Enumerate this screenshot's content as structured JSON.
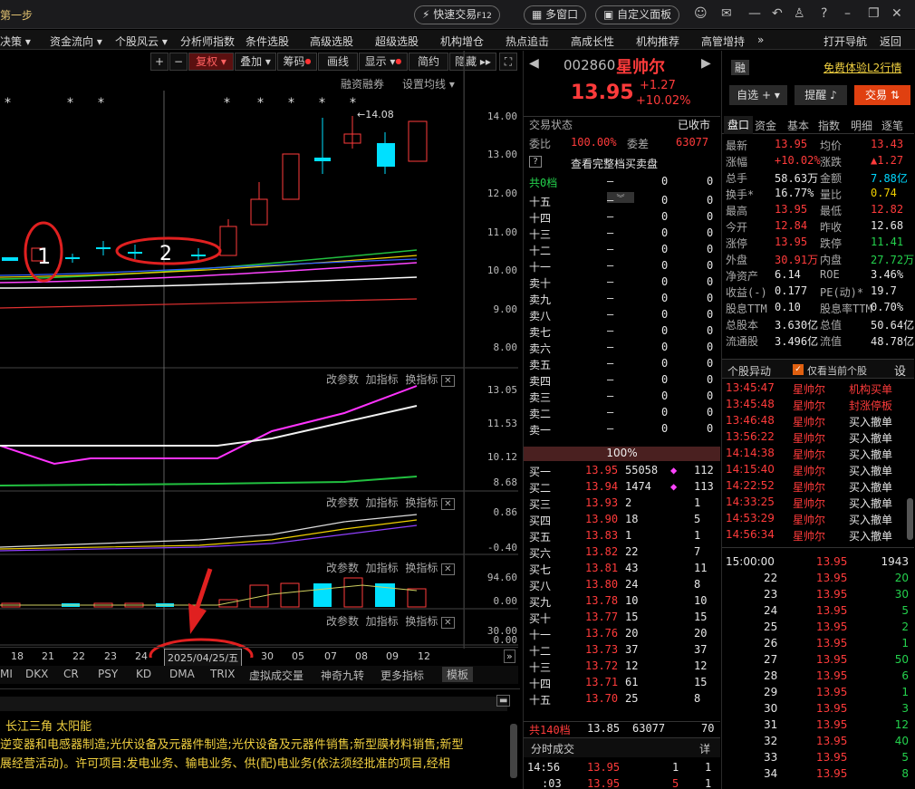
{
  "window": {
    "title": "第一步",
    "quick_trade": "快速交易",
    "quick_trade_key": "F12",
    "multi_window": "多窗口",
    "custom_panel": "自定义面板"
  },
  "menu": {
    "items": [
      "决策 ▾",
      "资金流向 ▾",
      "个股风云 ▾",
      "分析师指数",
      "条件选股",
      "高级选股",
      "超级选股",
      "机构增仓",
      "热点追击",
      "高成长性",
      "机构推荐",
      "高管增持"
    ],
    "more": "»",
    "right": [
      "打开导航",
      "返回"
    ]
  },
  "chart_toolbar": {
    "plus": "+",
    "minus": "−",
    "fq": "复权 ▾",
    "overlay": "叠加 ▾",
    "chips": "筹码",
    "draw": "画线",
    "display": "显示 ▾",
    "simple": "简约",
    "hide": "隐藏 ▸▸"
  },
  "main_chart": {
    "rz": "融资融券",
    "ma": "设置均线 ▾",
    "high_label": "←14.08",
    "yaxis": [
      "14.00",
      "13.00",
      "12.00",
      "11.00",
      "10.00",
      "9.00",
      "8.00"
    ],
    "annotations": [
      "1",
      "2"
    ],
    "markers": [
      "*",
      "*",
      "*",
      "*",
      "*",
      "*",
      "*",
      "*"
    ]
  },
  "sub1": {
    "btns": [
      "改参数",
      "加指标",
      "换指标"
    ],
    "yaxis": [
      "13.05",
      "11.53",
      "10.12",
      "8.68"
    ]
  },
  "sub2": {
    "btns": [
      "改参数",
      "加指标",
      "换指标"
    ],
    "yaxis": [
      "0.86",
      "-0.40"
    ]
  },
  "sub3": {
    "btns": [
      "改参数",
      "加指标",
      "换指标"
    ],
    "yaxis": [
      "94.60",
      "0.00"
    ]
  },
  "sub4": {
    "btns": [
      "改参数",
      "加指标",
      "换指标"
    ],
    "yaxis": [
      "30.00",
      "0.00"
    ]
  },
  "xaxis": {
    "dates": [
      "18",
      "21",
      "22",
      "23",
      "24",
      "2025/04/25/五",
      "30",
      "05",
      "07",
      "08",
      "09",
      "12"
    ]
  },
  "indicator_tabs": [
    "MI",
    "DKX",
    "CR",
    "PSY",
    "KD",
    "DMA",
    "TRIX",
    "虚拟成交量",
    "神奇九转",
    "更多指标",
    "模板"
  ],
  "bottom_info": {
    "line1": "长江三角  太阳能",
    "line2": "逆变器和电感器制造;光伏设备及元器件制造;光伏设备及元器件销售;新型膜材料销售;新型",
    "line3": "展经营活动)。许可项目:发电业务、输电业务、供(配)电业务(依法须经批准的项目,经相"
  },
  "stock": {
    "code": "002860",
    "name": "星帅尔",
    "price": "13.95",
    "change": "+1.27",
    "pct": "+10.02%",
    "rong": "融",
    "l2": "免费体验L2行情",
    "watch": "自选 + ▾",
    "remind": "提醒",
    "trade": "交易"
  },
  "status": {
    "label": "交易状态",
    "value": "已收市",
    "wb_label": "委比",
    "wb": "100.00%",
    "wc_label": "委差",
    "wc": "63077",
    "full_book": "查看完整档买卖盘",
    "total_label": "共0档",
    "total_v1": "0",
    "total_v2": "0"
  },
  "asks": [
    {
      "l": "十五",
      "p": "—",
      "v": "0",
      "n": "0"
    },
    {
      "l": "十四",
      "p": "—",
      "v": "0",
      "n": "0"
    },
    {
      "l": "十三",
      "p": "—",
      "v": "0",
      "n": "0"
    },
    {
      "l": "十二",
      "p": "—",
      "v": "0",
      "n": "0"
    },
    {
      "l": "十一",
      "p": "—",
      "v": "0",
      "n": "0"
    },
    {
      "l": "卖十",
      "p": "—",
      "v": "0",
      "n": "0"
    },
    {
      "l": "卖九",
      "p": "—",
      "v": "0",
      "n": "0"
    },
    {
      "l": "卖八",
      "p": "—",
      "v": "0",
      "n": "0"
    },
    {
      "l": "卖七",
      "p": "—",
      "v": "0",
      "n": "0"
    },
    {
      "l": "卖六",
      "p": "—",
      "v": "0",
      "n": "0"
    },
    {
      "l": "卖五",
      "p": "—",
      "v": "0",
      "n": "0"
    },
    {
      "l": "卖四",
      "p": "—",
      "v": "0",
      "n": "0"
    },
    {
      "l": "卖三",
      "p": "—",
      "v": "0",
      "n": "0"
    },
    {
      "l": "卖二",
      "p": "—",
      "v": "0",
      "n": "0"
    },
    {
      "l": "卖一",
      "p": "—",
      "v": "0",
      "n": "0"
    }
  ],
  "ratio": "100%",
  "bids": [
    {
      "l": "买一",
      "p": "13.95",
      "v": "55058",
      "n": "112",
      "m": "◆"
    },
    {
      "l": "买二",
      "p": "13.94",
      "v": "1474",
      "n": "113",
      "m": "◆"
    },
    {
      "l": "买三",
      "p": "13.93",
      "v": "2",
      "n": "1",
      "m": ""
    },
    {
      "l": "买四",
      "p": "13.90",
      "v": "18",
      "n": "5",
      "m": ""
    },
    {
      "l": "买五",
      "p": "13.83",
      "v": "1",
      "n": "1",
      "m": ""
    },
    {
      "l": "买六",
      "p": "13.82",
      "v": "22",
      "n": "7",
      "m": ""
    },
    {
      "l": "买七",
      "p": "13.81",
      "v": "43",
      "n": "11",
      "m": ""
    },
    {
      "l": "买八",
      "p": "13.80",
      "v": "24",
      "n": "8",
      "m": ""
    },
    {
      "l": "买九",
      "p": "13.78",
      "v": "10",
      "n": "10",
      "m": ""
    },
    {
      "l": "买十",
      "p": "13.77",
      "v": "15",
      "n": "15",
      "m": ""
    },
    {
      "l": "十一",
      "p": "13.76",
      "v": "20",
      "n": "20",
      "m": ""
    },
    {
      "l": "十二",
      "p": "13.73",
      "v": "37",
      "n": "37",
      "m": ""
    },
    {
      "l": "十三",
      "p": "13.72",
      "v": "12",
      "n": "12",
      "m": ""
    },
    {
      "l": "十四",
      "p": "13.71",
      "v": "61",
      "n": "15",
      "m": ""
    },
    {
      "l": "十五",
      "p": "13.70",
      "v": "25",
      "n": "8",
      "m": ""
    }
  ],
  "bid_total": {
    "l": "共140档",
    "p": "13.85",
    "v": "63077",
    "n": "70"
  },
  "fsc": {
    "title": "分时成交",
    "detail": "详",
    "rows": [
      {
        "t": "14:56",
        "p": "13.95",
        "v": "1",
        "n": "1"
      },
      {
        "t": ":03",
        "p": "13.95",
        "v": "5",
        "n": "1"
      }
    ]
  },
  "qtabs": [
    "盘口",
    "资金",
    "基本",
    "指数",
    "明细",
    "逐笔"
  ],
  "quote": [
    {
      "a": "最新",
      "av": "13.95",
      "b": "均价",
      "bv": "13.43",
      "ac": "red",
      "bc": "red"
    },
    {
      "a": "涨幅",
      "av": "+10.02%",
      "b": "涨跌",
      "bv": "▲1.27",
      "ac": "red",
      "bc": "red"
    },
    {
      "a": "总手",
      "av": "58.63万",
      "b": "金额",
      "bv": "7.88亿",
      "ac": "wht",
      "bc": "cyn"
    },
    {
      "a": "换手*",
      "av": "16.77%",
      "b": "量比",
      "bv": "0.74",
      "ac": "wht",
      "bc": "yel"
    },
    {
      "a": "最高",
      "av": "13.95",
      "b": "最低",
      "bv": "12.82",
      "ac": "red",
      "bc": "red"
    },
    {
      "a": "今开",
      "av": "12.84",
      "b": "昨收",
      "bv": "12.68",
      "ac": "red",
      "bc": "wht"
    },
    {
      "a": "涨停",
      "av": "13.95",
      "b": "跌停",
      "bv": "11.41",
      "ac": "red",
      "bc": "grn"
    },
    {
      "a": "外盘",
      "av": "30.91万",
      "b": "内盘",
      "bv": "27.72万",
      "ac": "red",
      "bc": "grn"
    },
    {
      "a": "净资产",
      "av": "6.14",
      "b": "ROE",
      "bv": "3.46%",
      "ac": "wht",
      "bc": "wht"
    },
    {
      "a": "收益(-)",
      "av": "0.177",
      "b": "PE(动)*",
      "bv": "19.7",
      "ac": "wht",
      "bc": "wht"
    },
    {
      "a": "股息TTM",
      "av": "0.10",
      "b": "股息率TTM",
      "bv": "0.70%",
      "ac": "wht",
      "bc": "wht"
    },
    {
      "a": "总股本",
      "av": "3.630亿",
      "b": "总值",
      "bv": "50.64亿",
      "ac": "wht",
      "bc": "wht"
    },
    {
      "a": "流通股",
      "av": "3.496亿",
      "b": "流值",
      "bv": "48.78亿",
      "ac": "wht",
      "bc": "wht"
    }
  ],
  "events": {
    "title": "个股异动",
    "chk": "仅看当前个股",
    "set": "设",
    "rows": [
      {
        "t": "13:45:47",
        "n": "星帅尔",
        "e": "机构买单",
        "c": "red"
      },
      {
        "t": "13:45:48",
        "n": "星帅尔",
        "e": "封涨停板",
        "c": "red"
      },
      {
        "t": "13:46:48",
        "n": "星帅尔",
        "e": "买入撤单",
        "c": "wht"
      },
      {
        "t": "13:56:22",
        "n": "星帅尔",
        "e": "买入撤单",
        "c": "wht"
      },
      {
        "t": "14:14:38",
        "n": "星帅尔",
        "e": "买入撤单",
        "c": "wht"
      },
      {
        "t": "14:15:40",
        "n": "星帅尔",
        "e": "买入撤单",
        "c": "wht"
      },
      {
        "t": "14:22:52",
        "n": "星帅尔",
        "e": "买入撤单",
        "c": "wht"
      },
      {
        "t": "14:33:25",
        "n": "星帅尔",
        "e": "买入撤单",
        "c": "wht"
      },
      {
        "t": "14:53:29",
        "n": "星帅尔",
        "e": "买入撤单",
        "c": "wht"
      },
      {
        "t": "14:56:34",
        "n": "星帅尔",
        "e": "买入撤单",
        "c": "wht"
      }
    ]
  },
  "ticks": [
    {
      "t": "15:00:00",
      "p": "13.95",
      "v": "1943"
    },
    {
      "t": "22",
      "p": "13.95",
      "v": "20"
    },
    {
      "t": "23",
      "p": "13.95",
      "v": "30"
    },
    {
      "t": "24",
      "p": "13.95",
      "v": "5"
    },
    {
      "t": "25",
      "p": "13.95",
      "v": "2"
    },
    {
      "t": "26",
      "p": "13.95",
      "v": "1"
    },
    {
      "t": "27",
      "p": "13.95",
      "v": "50"
    },
    {
      "t": "28",
      "p": "13.95",
      "v": "6"
    },
    {
      "t": "29",
      "p": "13.95",
      "v": "1"
    },
    {
      "t": "30",
      "p": "13.95",
      "v": "3"
    },
    {
      "t": "31",
      "p": "13.95",
      "v": "12"
    },
    {
      "t": "32",
      "p": "13.95",
      "v": "40"
    },
    {
      "t": "33",
      "p": "13.95",
      "v": "5"
    },
    {
      "t": "34",
      "p": "13.95",
      "v": "8"
    }
  ]
}
